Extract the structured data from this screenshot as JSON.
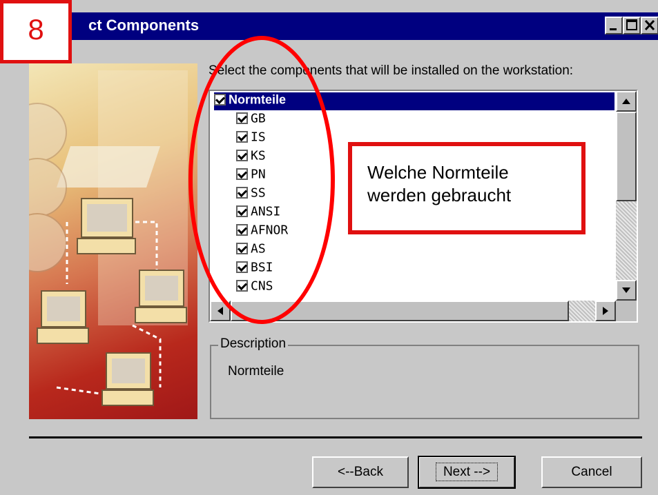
{
  "window": {
    "title": "ct Components"
  },
  "step_badge": "8",
  "prompt": "Select the components that will be installed on the workstation:",
  "components": [
    {
      "label": "Normteile",
      "checked": true,
      "selected": true
    },
    {
      "label": "GB",
      "checked": true
    },
    {
      "label": "IS",
      "checked": true
    },
    {
      "label": "KS",
      "checked": true
    },
    {
      "label": "PN",
      "checked": true
    },
    {
      "label": "SS",
      "checked": true
    },
    {
      "label": "ANSI",
      "checked": true
    },
    {
      "label": "AFNOR",
      "checked": true
    },
    {
      "label": "AS",
      "checked": true
    },
    {
      "label": "BSI",
      "checked": true
    },
    {
      "label": "CNS",
      "checked": true
    }
  ],
  "description": {
    "legend": "Description",
    "text": "Normteile"
  },
  "callout": "Welche Normteile\nwerden gebraucht",
  "buttons": {
    "back": "<--Back",
    "next": "Next -->",
    "cancel": "Cancel"
  },
  "colors": {
    "titlebar": "#000080",
    "annotation": "#e01010",
    "dialog_bg": "#c8c8c8"
  },
  "icons": [
    "minimize-icon",
    "maximize-icon",
    "close-icon",
    "scroll-up-icon",
    "scroll-down-icon",
    "scroll-left-icon",
    "scroll-right-icon",
    "checkbox-checked-icon"
  ]
}
